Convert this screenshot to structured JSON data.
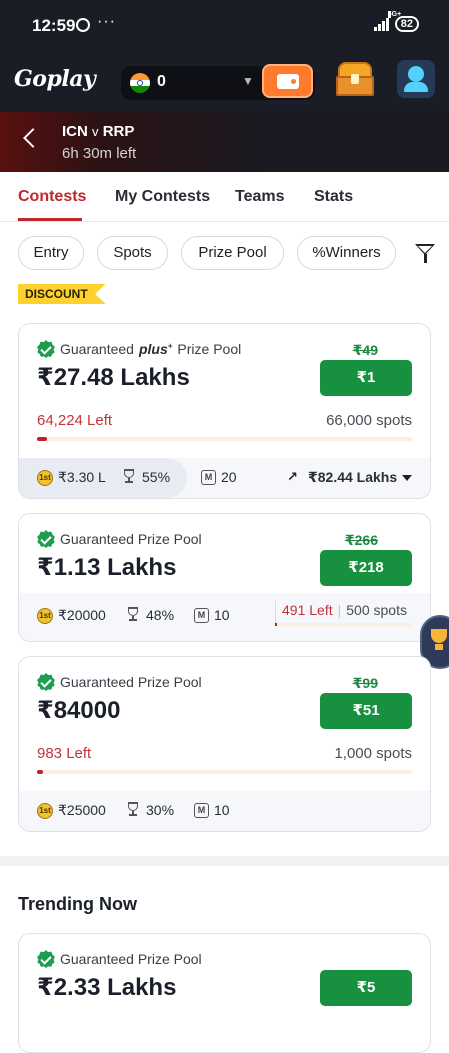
{
  "status_bar": {
    "time": "12:59",
    "dots": "···",
    "network": "5G+",
    "battery": "82"
  },
  "header": {
    "logo": "Goplay",
    "balance": "0"
  },
  "match": {
    "team1": "ICN",
    "vs": "v",
    "team2": "RRP",
    "time_left": "6h 30m left"
  },
  "tabs": [
    "Contests",
    "My Contests",
    "Teams",
    "Stats"
  ],
  "filters": [
    "Entry",
    "Spots",
    "Prize Pool",
    "%Winners"
  ],
  "discount_label": "DISCOUNT",
  "contests": [
    {
      "guarantee_prefix": "Guaranteed",
      "plus_label": "plus",
      "plus_sup": "+",
      "guarantee_suffix": "Prize Pool",
      "prize": "₹27.48 Lakhs",
      "old_price": "₹49",
      "entry": "₹1",
      "left": "64,224 Left",
      "spots": "66,000 spots",
      "fill_fraction": 0.027,
      "first_prize": "₹3.30 L",
      "winners": "55%",
      "max_entries": "20",
      "trend_value": "₹82.44 Lakhs"
    },
    {
      "guarantee": "Guaranteed Prize Pool",
      "prize": "₹1.13 Lakhs",
      "old_price": "₹266",
      "entry": "₹218",
      "left": "491 Left",
      "spots": "500 spots",
      "fill_fraction": 0.018,
      "first_prize": "₹20000",
      "winners": "48%",
      "max_entries": "10"
    },
    {
      "guarantee": "Guaranteed Prize Pool",
      "prize": "₹84000",
      "old_price": "₹99",
      "entry": "₹51",
      "left": "983 Left",
      "spots": "1,000 spots",
      "fill_fraction": 0.017,
      "first_prize": "₹25000",
      "winners": "30%",
      "max_entries": "10"
    }
  ],
  "trending": {
    "title": "Trending Now",
    "contest": {
      "guarantee": "Guaranteed Prize Pool",
      "prize": "₹2.33 Lakhs",
      "entry": "₹5"
    }
  },
  "icons": {
    "coin_letter": "1st",
    "m_letter": "M"
  },
  "colors": {
    "accent": "#c0282d",
    "join_green": "#17913f",
    "left_red": "#c4323a",
    "discount_yellow": "#ffd12f"
  }
}
